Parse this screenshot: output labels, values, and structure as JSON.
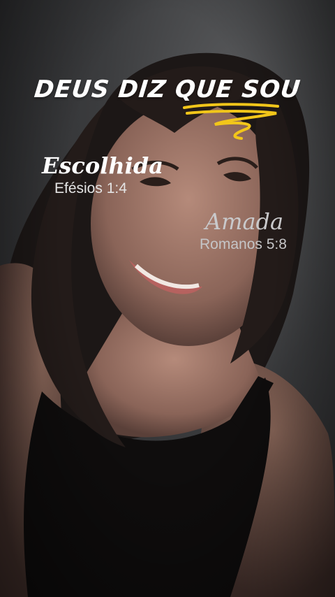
{
  "overlay": {
    "title": "DEUS DIZ QUE SOU",
    "accent_color": "#f2c61a",
    "items": [
      {
        "label": "Escolhida",
        "reference": "Efésios 1:4"
      },
      {
        "label": "Amada",
        "reference": "Romanos 5:8"
      }
    ]
  }
}
